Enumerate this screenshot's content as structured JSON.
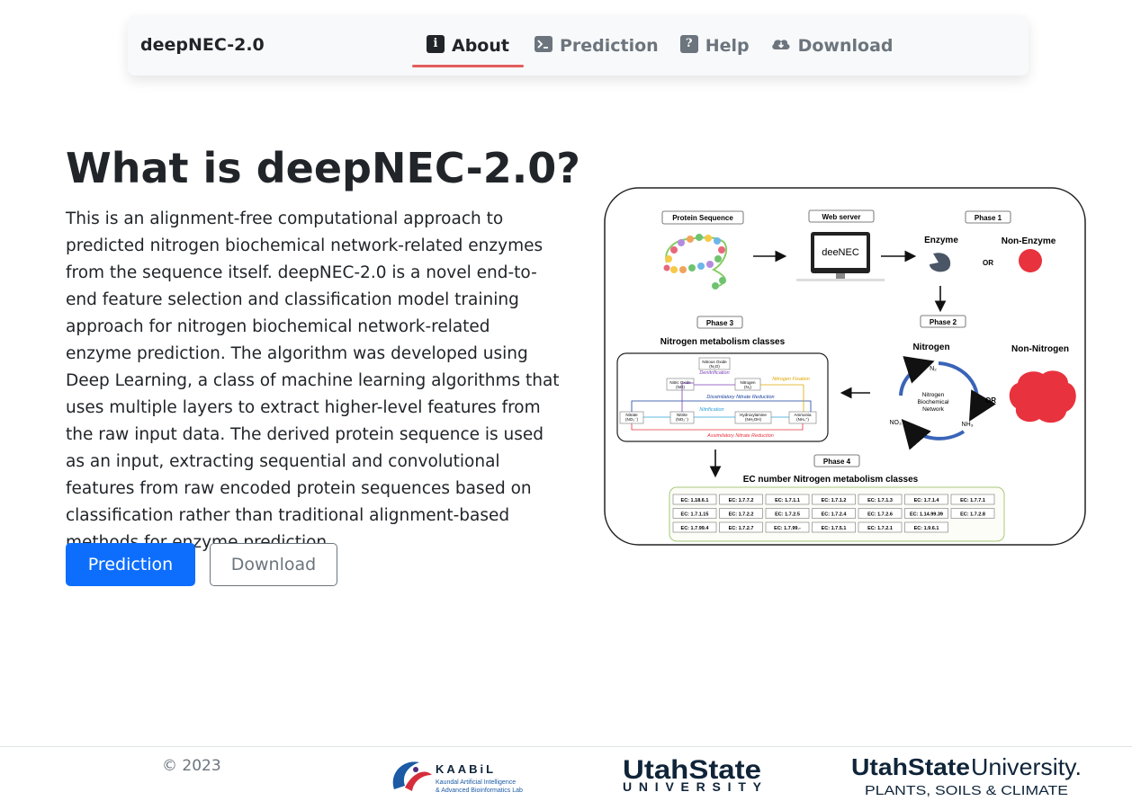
{
  "navbar": {
    "brand": "deepNEC-2.0",
    "items": [
      {
        "label": "About",
        "icon": "info-icon",
        "active": true
      },
      {
        "label": "Prediction",
        "icon": "terminal-icon"
      },
      {
        "label": "Help",
        "icon": "question-icon"
      },
      {
        "label": "Download",
        "icon": "cloud-download-icon"
      }
    ]
  },
  "hero": {
    "title": "What is deepNEC-2.0?",
    "description": "This is an alignment-free computational approach to predicted nitrogen biochemical network-related enzymes from the sequence itself. deepNEC-2.0 is a novel end-to-end feature selection and classification model training approach for nitrogen biochemical network-related enzyme prediction. The algorithm was developed using Deep Learning, a class of machine learning algorithms that uses multiple layers to extract higher-level features from the raw input data. The derived protein sequence is used as an input, extracting sequential and convolutional features from raw encoded protein sequences based on classification rather than traditional alignment-based methods for enzyme prediction.",
    "primary_button": "Prediction",
    "secondary_button": "Download"
  },
  "figure": {
    "protein_sequence": "Protein Sequence",
    "web_server": "Web server",
    "server_name": "deeNEC",
    "phase1": "Phase 1",
    "phase2": "Phase 2",
    "phase3": "Phase 3",
    "phase4": "Phase 4",
    "enzyme": "Enzyme",
    "non_enzyme": "Non-Enzyme",
    "or": "OR",
    "nitrogen": "Nitrogen",
    "non_nitrogen": "Non-Nitrogen",
    "n2": "N₂",
    "no3": "NO₃⁻",
    "nh3": "NH₃",
    "nbn": [
      "Nitrogen",
      "Biochemical",
      "Network"
    ],
    "nm_classes": "Nitrogen metabolism classes",
    "ec_classes": "EC number Nitrogen metabolism classes",
    "pathway_labels": {
      "nitrous_oxide": "Nitrous Oxide",
      "nitrous_oxide_formula": "(N₂O)",
      "denitrification": "Denitrification",
      "nitric_oxide": "Nitric Oxide",
      "nitric_oxide_formula": "(NO)",
      "nitrogen": "Nitrogen",
      "nitrogen_formula": "(N₂)",
      "nitrogen_fixation": "Nitrogen Fixation",
      "dissimilatory": "Dissimilatory Nitrate Reduction",
      "nitrification": "Nitrification",
      "nitrate": "Nitrate",
      "nitrate_formula": "(NO₃⁻)",
      "nitrite": "Nitrite",
      "nitrite_formula": "(NO₂⁻)",
      "hydroxylamine": "Hydroxylamine",
      "hydroxylamine_formula": "(NH₂OH)",
      "ammonia": "Ammonia",
      "ammonia_formula": "(NH₄⁺)",
      "assimilatory": "Assimilatory Nitrate Reduction"
    },
    "ec_table": [
      [
        "EC: 1.18.6.1",
        "EC: 1.7.7.2",
        "EC: 1.7.1.1",
        "EC: 1.7.1.2",
        "EC: 1.7.1.3",
        "EC: 1.7.1.4",
        "EC: 1.7.7.1"
      ],
      [
        "EC: 1.7.1.15",
        "EC: 1.7.2.2",
        "EC: 1.7.2.5",
        "EC: 1.7.2.4",
        "EC: 1.7.2.6",
        "EC: 1.14.99.39",
        "EC: 1.7.2.8"
      ],
      [
        "EC: 1.7.99.4",
        "EC: 1.7.2.7",
        "EC: 1.7.99.-",
        "EC: 1.7.5.1",
        "EC: 1.7.2.1",
        "EC: 1.9.6.1"
      ]
    ]
  },
  "footer": {
    "copyright": "© 2023",
    "kaabil": {
      "name": "KAABiL",
      "line1": "Kaundal Artificial Intelligence",
      "line2": "& Advanced Bioinformatics Lab"
    },
    "usu": {
      "top": "UtahState",
      "bottom": "UNIVERSITY"
    },
    "psc": {
      "top1": "UtahState",
      "top2": "University.",
      "bottom": "PLANTS, SOILS & CLIMATE"
    }
  },
  "colors": {
    "primary": "#0d6efd",
    "nav_active_underline": "#e35d5d",
    "usu_blue": "#0f2439",
    "enzyme_red": "#e8323d"
  }
}
